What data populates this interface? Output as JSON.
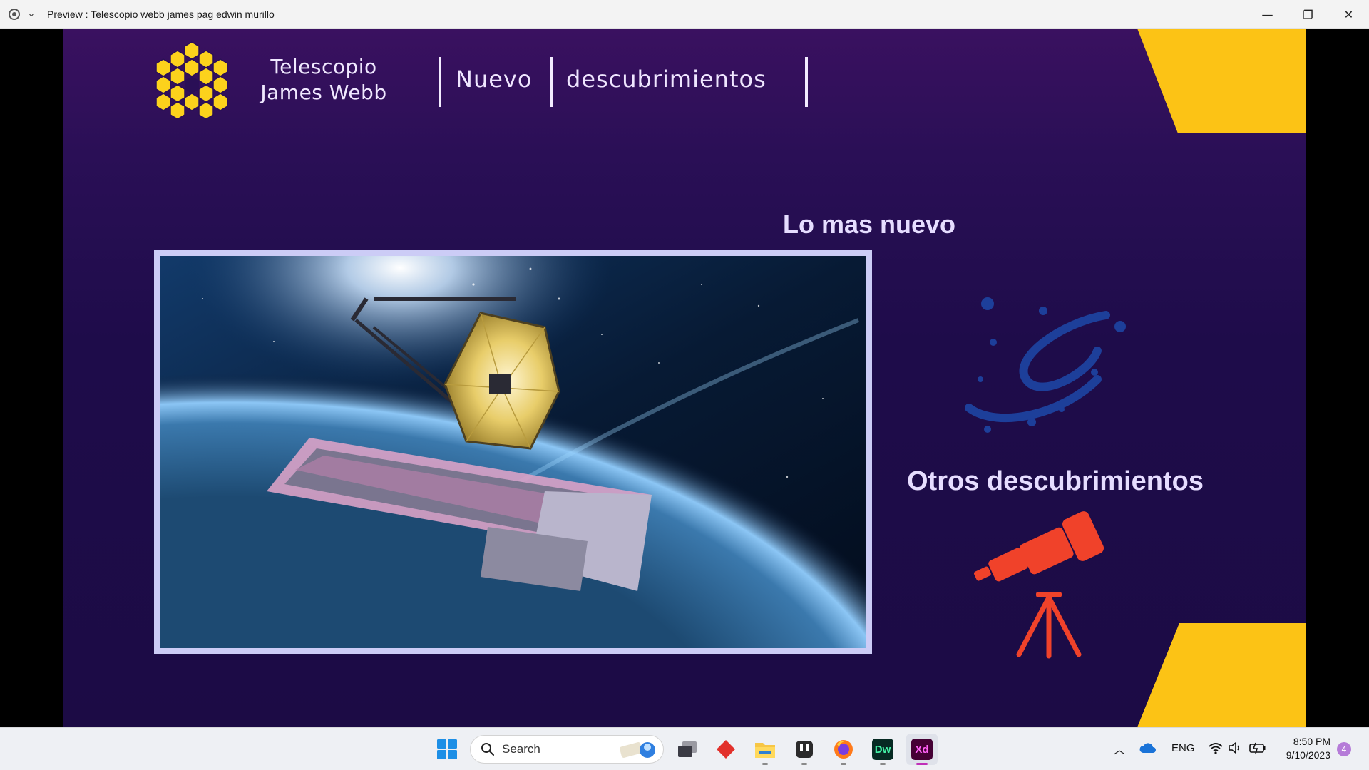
{
  "window": {
    "title": "Preview : Telescopio webb james pag edwin murillo",
    "minimize": "—",
    "restore": "❐",
    "close": "✕"
  },
  "page": {
    "brand_line1": "Telescopio",
    "brand_line2": "James Webb",
    "nav": [
      "Nuevo",
      "descubrimientos"
    ],
    "heading_new": "Lo mas nuevo",
    "heading_other": "Otros descubrimientos",
    "hero_image": "James Webb Space Telescope over Earth",
    "colors": {
      "accent_yellow": "#fcc315",
      "background": "#1e0c4a",
      "galaxy_blue": "#1d3f9a",
      "telescope_red": "#f0422a"
    }
  },
  "taskbar": {
    "search_label": "Search",
    "apps": [
      "start-icon",
      "task-view-icon",
      "todoist-icon",
      "file-explorer-icon",
      "app-icon",
      "firefox-icon",
      "dreamweaver-icon",
      "xd-icon"
    ],
    "dw_label": "Dw",
    "xd_label": "Xd",
    "language": "ENG",
    "time": "8:50 PM",
    "date": "9/10/2023",
    "notification_count": "4"
  }
}
